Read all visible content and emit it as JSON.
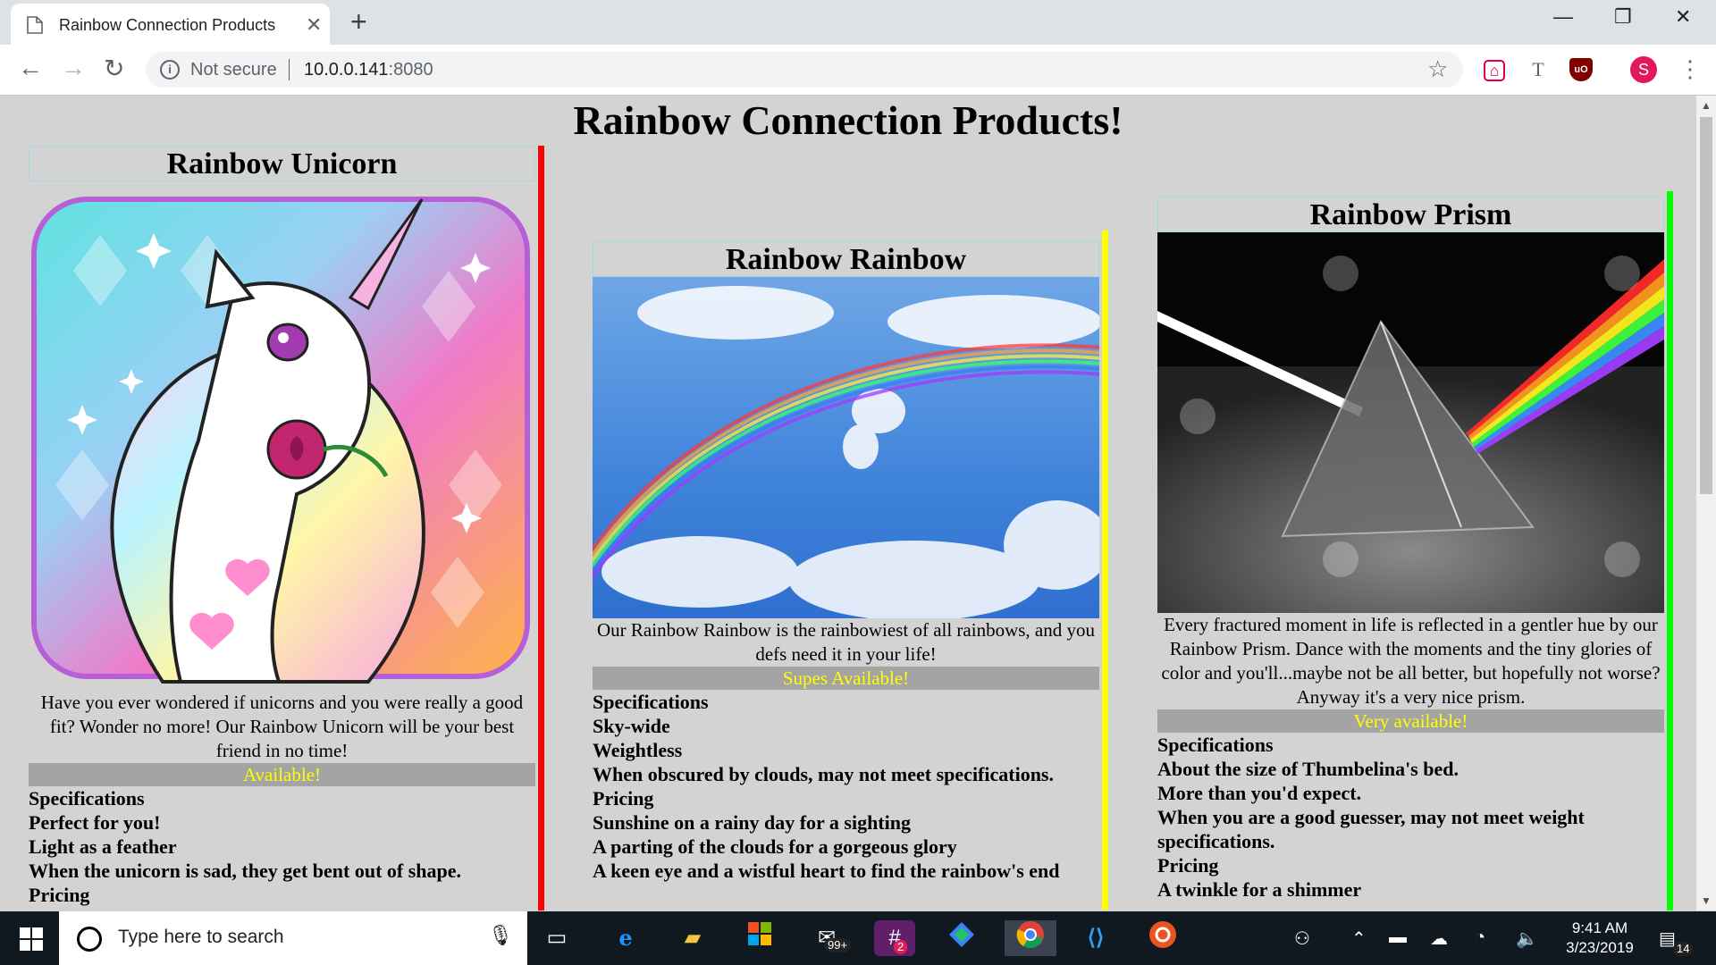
{
  "browser": {
    "tab_title": "Rainbow Connection Products",
    "tab_close": "✕",
    "new_tab": "+",
    "security_label": "Not secure",
    "url_host": "10.0.0.141",
    "url_port": ":8080",
    "profile_initial": "S",
    "window_minimize": "—",
    "window_restore": "❐",
    "window_close": "✕"
  },
  "page": {
    "title": "Rainbow Connection Products!",
    "products": [
      {
        "name": "Rainbow Unicorn",
        "image_icon": "unicorn-image",
        "description": "Have you ever wondered if unicorns and you were really a good fit? Wonder no more! Our Rainbow Unicorn will be your best friend in no time!",
        "availability": "Available!",
        "specs_heading": "Specifications",
        "specs": [
          "Perfect for you!",
          "Light as a feather",
          "When the unicorn is sad, they get bent out of shape."
        ],
        "pricing_heading": "Pricing",
        "pricing": [],
        "accent": "#ff0000"
      },
      {
        "name": "Rainbow Rainbow",
        "image_icon": "rainbow-sky-image",
        "description": "Our Rainbow Rainbow is the rainbowiest of all rainbows, and you defs need it in your life!",
        "availability": "Supes Available!",
        "specs_heading": "Specifications",
        "specs": [
          "Sky-wide",
          "Weightless",
          "When obscured by clouds, may not meet specifications."
        ],
        "pricing_heading": "Pricing",
        "pricing": [
          "Sunshine on a rainy day for a sighting",
          "A parting of the clouds for a gorgeous glory",
          "A keen eye and a wistful heart to find the rainbow's end"
        ],
        "accent": "#ffff00"
      },
      {
        "name": "Rainbow Prism",
        "image_icon": "prism-image",
        "description": "Every fractured moment in life is reflected in a gentler hue by our Rainbow Prism. Dance with the moments and the tiny glories of color and you'll...maybe not be all better, but hopefully not worse? Anyway it's a very nice prism.",
        "availability": "Very available!",
        "specs_heading": "Specifications",
        "specs": [
          "About the size of Thumbelina's bed.",
          "More than you'd expect.",
          "When you are a good guesser, may not meet weight specifications."
        ],
        "pricing_heading": "Pricing",
        "pricing": [
          "A twinkle for a shimmer"
        ],
        "accent": "#00ff00"
      }
    ]
  },
  "taskbar": {
    "search_placeholder": "Type here to search",
    "mail_badge": "99+",
    "slack_badge": "2",
    "time": "9:41 AM",
    "date": "3/23/2019",
    "notification_count": "14"
  },
  "colors": {
    "page_bg": "#d3d3d3",
    "availability_bg": "#a4a4a4",
    "availability_text": "#ffff00",
    "taskbar_bg": "#101820"
  }
}
